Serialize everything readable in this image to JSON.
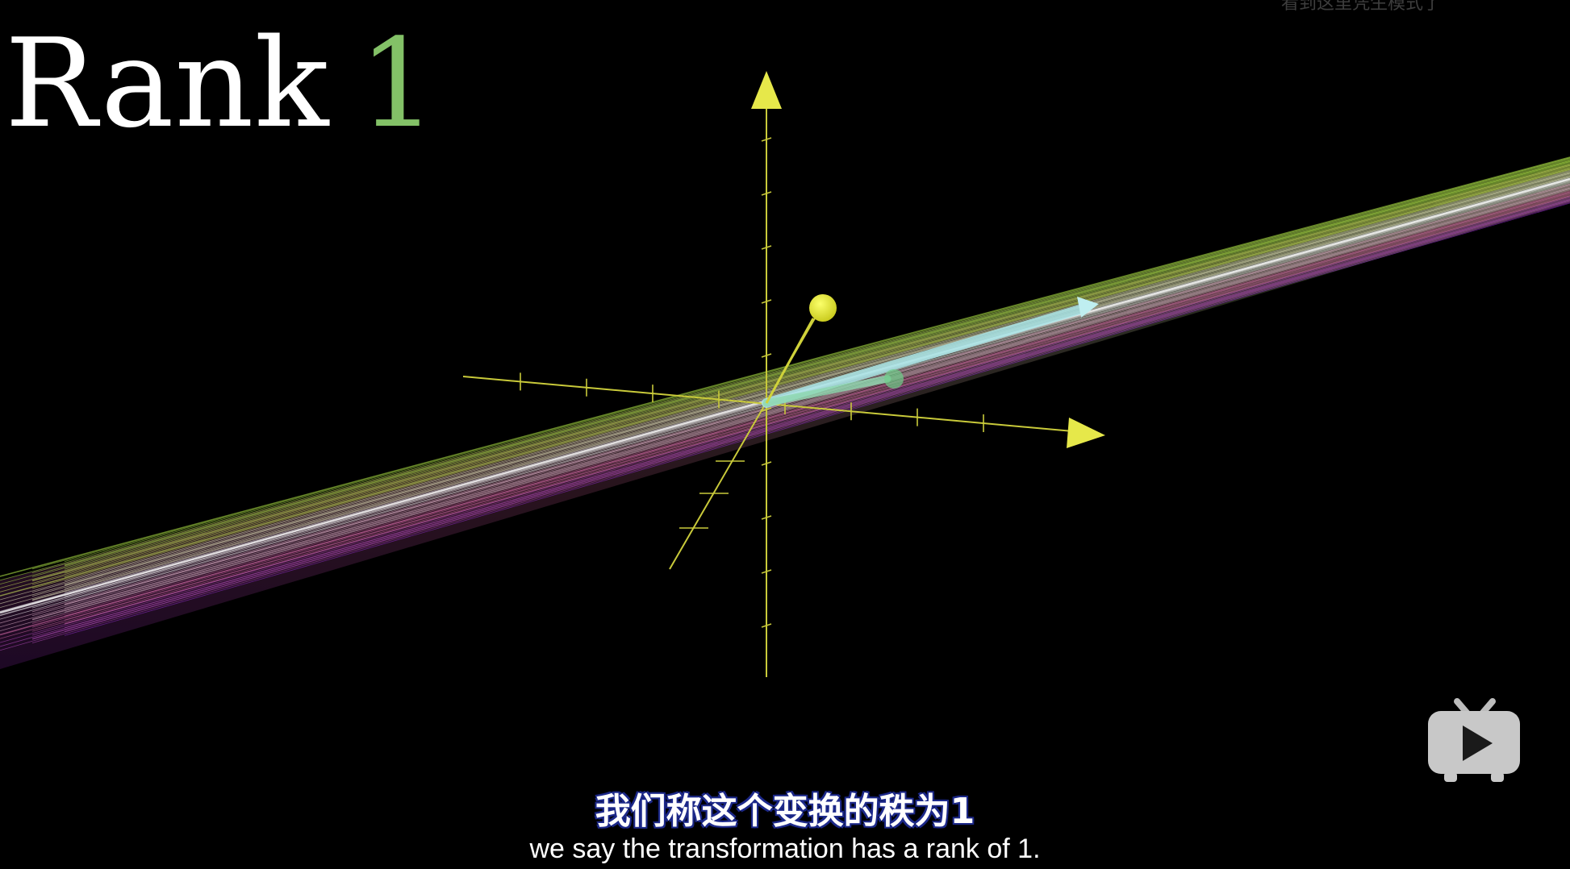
{
  "video": {
    "title_word": "Rank",
    "title_number": "1",
    "accent_color": "#83c167",
    "axis_color": "#e6e84a",
    "top_watermark": "看到这里凭生模式了"
  },
  "subtitles": {
    "chinese": "我们称这个变换的秩为1",
    "english": "we say the transformation has a rank of 1."
  },
  "icons": {
    "player_logo": "bilibili-tv-play-icon"
  }
}
